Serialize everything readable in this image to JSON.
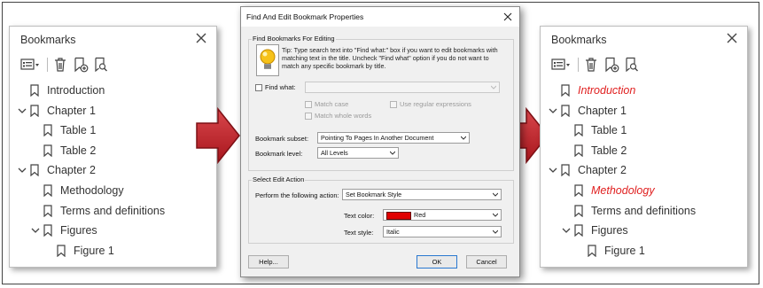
{
  "left_panel": {
    "title": "Bookmarks",
    "items": [
      {
        "label": "Introduction",
        "level": 0,
        "expander": false,
        "style": "normal"
      },
      {
        "label": "Chapter 1",
        "level": 0,
        "expander": true,
        "style": "normal"
      },
      {
        "label": "Table 1",
        "level": 1,
        "expander": false,
        "style": "normal"
      },
      {
        "label": "Table 2",
        "level": 1,
        "expander": false,
        "style": "normal"
      },
      {
        "label": "Chapter 2",
        "level": 0,
        "expander": true,
        "style": "normal"
      },
      {
        "label": "Methodology",
        "level": 1,
        "expander": false,
        "style": "normal"
      },
      {
        "label": "Terms and definitions",
        "level": 1,
        "expander": false,
        "style": "normal"
      },
      {
        "label": "Figures",
        "level": 1,
        "expander": true,
        "style": "normal"
      },
      {
        "label": "Figure 1",
        "level": 2,
        "expander": false,
        "style": "normal"
      }
    ]
  },
  "right_panel": {
    "title": "Bookmarks",
    "items": [
      {
        "label": "Introduction",
        "level": 0,
        "expander": false,
        "style": "red-italic"
      },
      {
        "label": "Chapter 1",
        "level": 0,
        "expander": true,
        "style": "normal"
      },
      {
        "label": "Table 1",
        "level": 1,
        "expander": false,
        "style": "normal"
      },
      {
        "label": "Table 2",
        "level": 1,
        "expander": false,
        "style": "normal"
      },
      {
        "label": "Chapter 2",
        "level": 0,
        "expander": true,
        "style": "normal"
      },
      {
        "label": "Methodology",
        "level": 1,
        "expander": false,
        "style": "red-italic"
      },
      {
        "label": "Terms and definitions",
        "level": 1,
        "expander": false,
        "style": "normal"
      },
      {
        "label": "Figures",
        "level": 1,
        "expander": true,
        "style": "normal"
      },
      {
        "label": "Figure 1",
        "level": 2,
        "expander": false,
        "style": "normal"
      }
    ]
  },
  "toolbar_icons": [
    "options-menu-icon",
    "delete-icon",
    "add-bookmark-icon",
    "bookmark-search-icon"
  ],
  "dialog": {
    "title": "Find And Edit Bookmark Properties",
    "find_group_label": "Find Bookmarks For Editing",
    "tip": "Tip: Type search text into \"Find what:\" box if you want to edit bookmarks with matching text in the title. Uncheck \"Find what\" option if you do not want to match any specific bookmark by title.",
    "find_what_label": "Find what:",
    "find_what_value": "",
    "match_case_label": "Match case",
    "use_regex_label": "Use regular expressions",
    "match_whole_words_label": "Match whole words",
    "bookmark_subset_label": "Bookmark subset:",
    "bookmark_subset_value": "Pointing To Pages In Another Document",
    "bookmark_level_label": "Bookmark level:",
    "bookmark_level_value": "All Levels",
    "edit_group_label": "Select Edit Action",
    "perform_action_label": "Perform the following action:",
    "perform_action_value": "Set Bookmark Style",
    "text_color_label": "Text color:",
    "text_color_value": "Red",
    "text_color_hex": "#e00000",
    "text_style_label": "Text style:",
    "text_style_value": "Italic",
    "help_button": "Help...",
    "ok_button": "OK",
    "cancel_button": "Cancel"
  },
  "colors": {
    "arrow_fill": "#c0262c",
    "highlight_text": "#e02020"
  }
}
